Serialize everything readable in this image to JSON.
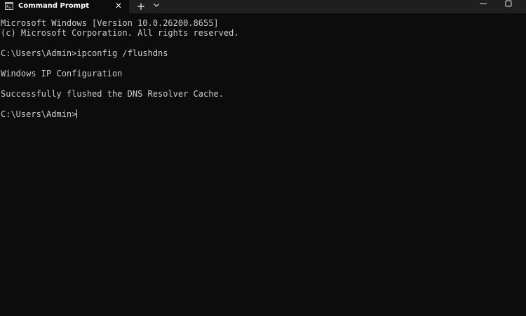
{
  "window": {
    "tab_title": "Command Prompt",
    "tab_icon": "cmd-icon",
    "close_tab_glyph": "×",
    "new_tab_glyph": "+"
  },
  "terminal": {
    "lines": [
      "Microsoft Windows [Version 10.0.26200.8655]",
      "(c) Microsoft Corporation. All rights reserved.",
      "C:\\Users\\Admin>ipconfig /flushdns",
      "Windows IP Configuration",
      "Successfully flushed the DNS Resolver Cache."
    ],
    "prompt": "C:\\Users\\Admin>"
  },
  "colors": {
    "background": "#0c0c0c",
    "titlebar": "#1f1f1f",
    "text": "#cccccc"
  }
}
